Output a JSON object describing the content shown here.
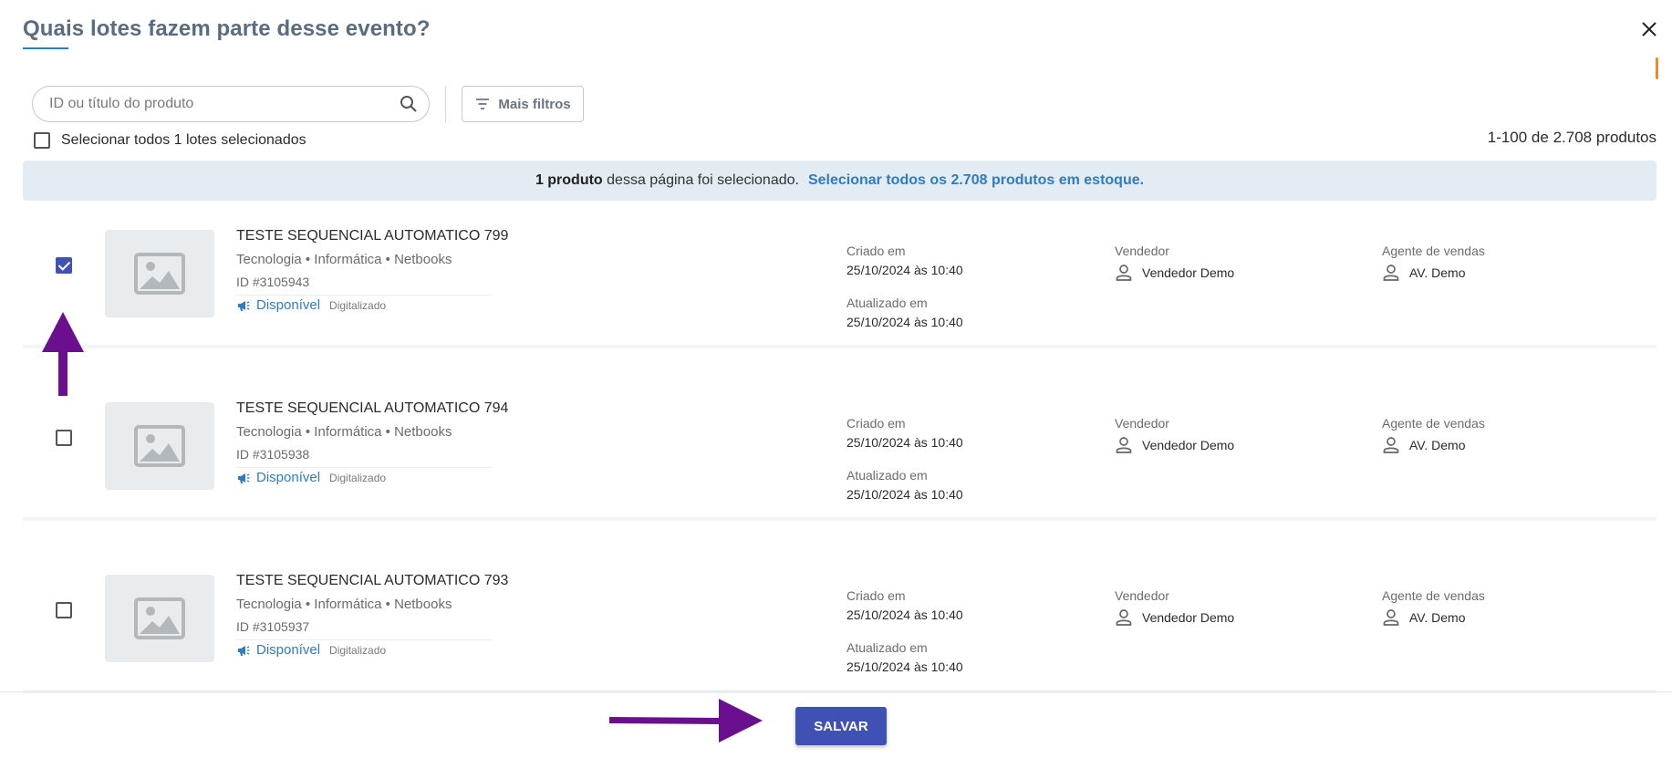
{
  "dialog": {
    "title": "Quais lotes fazem parte desse evento?",
    "close_label": "×"
  },
  "toolbar": {
    "search_placeholder": "ID ou título do produto",
    "filters_label": "Mais filtros",
    "select_all_label": "Selecionar todos 1 lotes selecionados",
    "pagination": "1-100 de 2.708 produtos"
  },
  "banner": {
    "count_bold": "1 produto",
    "text": " dessa página foi selecionado.",
    "link": "Selecionar todos os 2.708 produtos em estoque."
  },
  "labels": {
    "created": "Criado em",
    "updated": "Atualizado em",
    "seller": "Vendedor",
    "agent": "Agente de vendas",
    "status": "Disponível",
    "digitalized": "Digitalizado"
  },
  "products": [
    {
      "title": "TESTE SEQUENCIAL AUTOMATICO 799",
      "category": "Tecnologia • Informática • Netbooks",
      "id": "ID #3105943",
      "created": "25/10/2024 às 10:40",
      "updated": "25/10/2024 às 10:40",
      "seller": "Vendedor Demo",
      "agent": "AV. Demo",
      "checked": true
    },
    {
      "title": "TESTE SEQUENCIAL AUTOMATICO 794",
      "category": "Tecnologia • Informática • Netbooks",
      "id": "ID #3105938",
      "created": "25/10/2024 às 10:40",
      "updated": "25/10/2024 às 10:40",
      "seller": "Vendedor Demo",
      "agent": "AV. Demo",
      "checked": false
    },
    {
      "title": "TESTE SEQUENCIAL AUTOMATICO 793",
      "category": "Tecnologia • Informática • Netbooks",
      "id": "ID #3105937",
      "created": "25/10/2024 às 10:40",
      "updated": "25/10/2024 às 10:40",
      "seller": "Vendedor Demo",
      "agent": "AV. Demo",
      "checked": false
    }
  ],
  "footer": {
    "save_label": "SALVAR"
  },
  "colors": {
    "primary": "#3f51b5",
    "link": "#2f7cc0",
    "banner_bg": "#e3ecf3",
    "annotation_arrow": "#6a0f8e"
  }
}
